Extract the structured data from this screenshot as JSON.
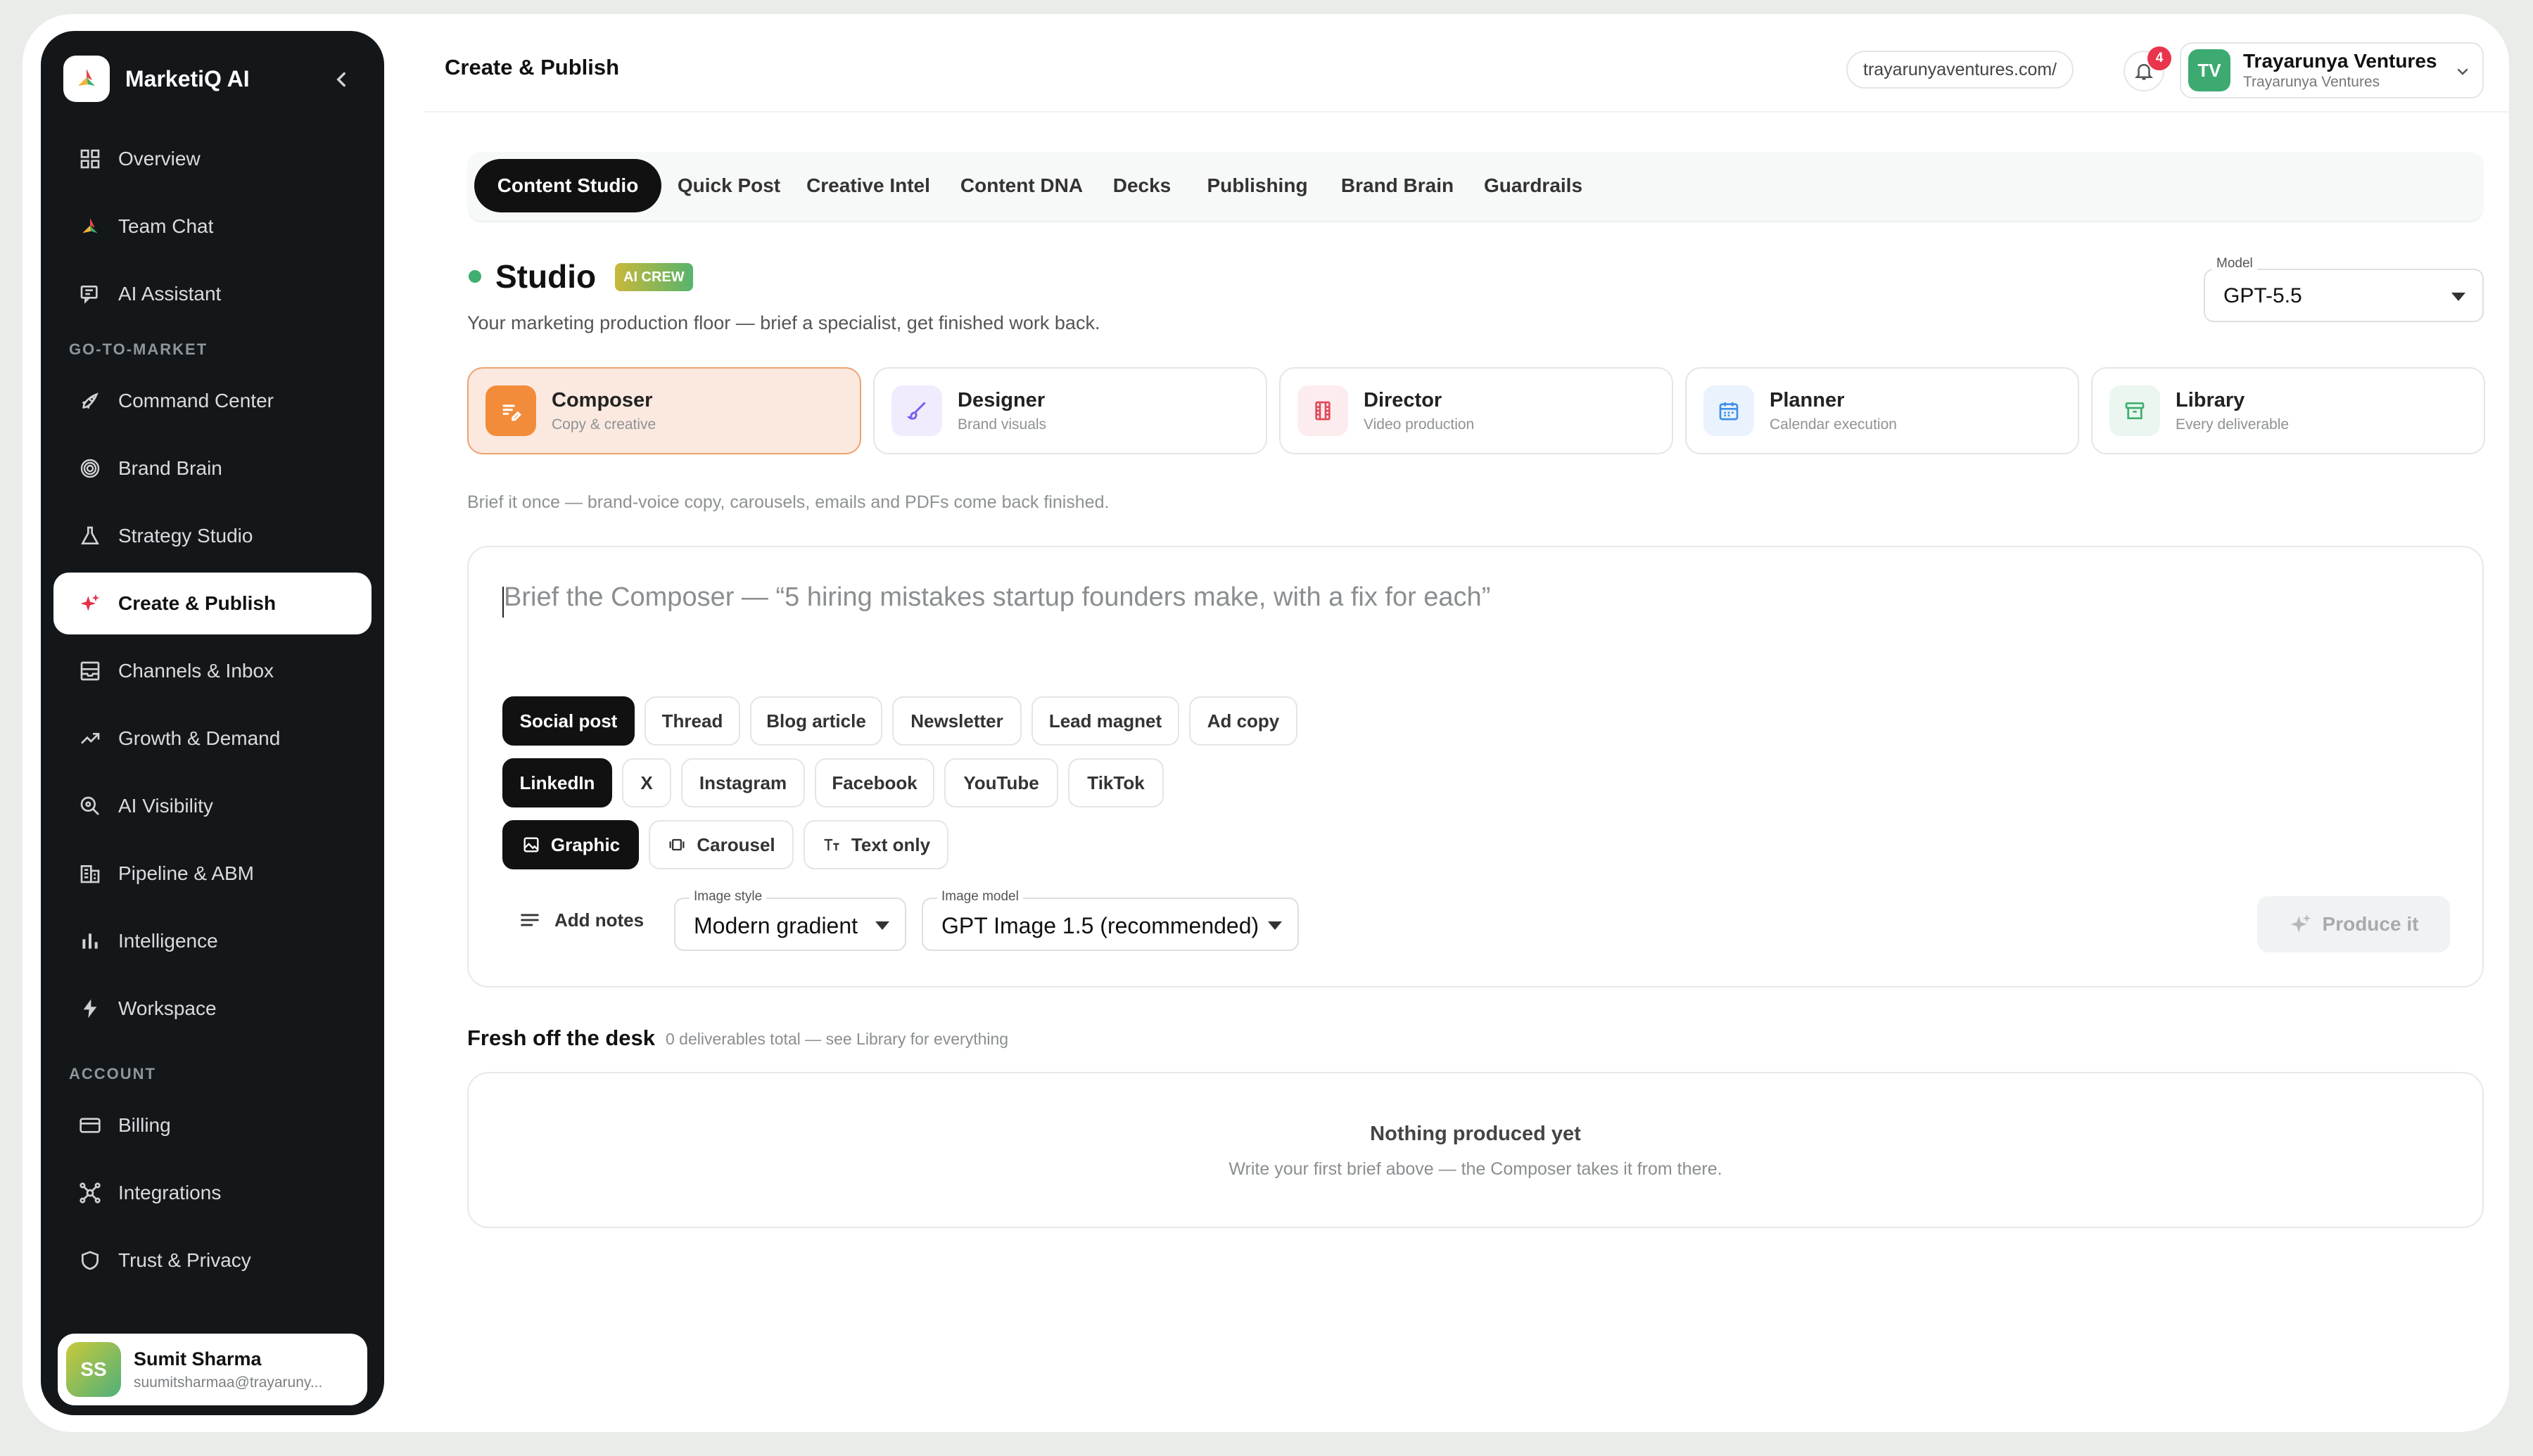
{
  "sidebar": {
    "brand": "MarketiQ AI",
    "items_top": [
      {
        "label": "Overview",
        "icon": "grid-icon"
      },
      {
        "label": "Team Chat",
        "icon": "spark-logo-icon"
      },
      {
        "label": "AI Assistant",
        "icon": "chat-icon"
      }
    ],
    "section_gtm": "GO-TO-MARKET",
    "items_gtm": [
      {
        "label": "Command Center",
        "icon": "rocket-icon"
      },
      {
        "label": "Brand Brain",
        "icon": "fingerprint-icon"
      },
      {
        "label": "Strategy Studio",
        "icon": "flask-icon"
      },
      {
        "label": "Create & Publish",
        "icon": "sparkles-icon"
      },
      {
        "label": "Channels & Inbox",
        "icon": "inbox-icon"
      },
      {
        "label": "Growth & Demand",
        "icon": "trend-up-icon"
      },
      {
        "label": "AI Visibility",
        "icon": "search-eye-icon"
      },
      {
        "label": "Pipeline & ABM",
        "icon": "building-icon"
      },
      {
        "label": "Intelligence",
        "icon": "bar-chart-icon"
      },
      {
        "label": "Workspace",
        "icon": "bolt-icon"
      }
    ],
    "section_account": "ACCOUNT",
    "items_account": [
      {
        "label": "Billing",
        "icon": "credit-card-icon"
      },
      {
        "label": "Integrations",
        "icon": "network-icon"
      },
      {
        "label": "Trust & Privacy",
        "icon": "shield-icon"
      }
    ],
    "user": {
      "initials": "SS",
      "name": "Sumit Sharma",
      "email": "suumitsharmaa@trayaruny..."
    }
  },
  "header": {
    "title": "Create & Publish",
    "url": "trayarunyaventures.com/",
    "notifications": "4",
    "account": {
      "initials": "TV",
      "name": "Trayarunya Ventures",
      "sub": "Trayarunya Ventures"
    }
  },
  "tabs": [
    "Content Studio",
    "Quick Post",
    "Creative Intel",
    "Content DNA",
    "Decks",
    "Publishing",
    "Brand Brain",
    "Guardrails"
  ],
  "studio": {
    "title": "Studio",
    "badge": "AI CREW",
    "subtitle": "Your marketing production floor — brief a specialist, get finished work back.",
    "model_label": "Model",
    "model_value": "GPT-5.5"
  },
  "specialists": [
    {
      "name": "Composer",
      "desc": "Copy & creative",
      "icon": "compose-icon",
      "color": "#f28c3a"
    },
    {
      "name": "Designer",
      "desc": "Brand visuals",
      "icon": "brush-icon",
      "color": "#7d5cf0"
    },
    {
      "name": "Director",
      "desc": "Video production",
      "icon": "film-icon",
      "color": "#e04a5a"
    },
    {
      "name": "Planner",
      "desc": "Calendar execution",
      "icon": "calendar-icon",
      "color": "#3b8ee8"
    },
    {
      "name": "Library",
      "desc": "Every deliverable",
      "icon": "archive-icon",
      "color": "#3fae6f"
    }
  ],
  "hint": "Brief it once — brand-voice copy, carousels, emails and PDFs come back finished.",
  "composer": {
    "placeholder": "Brief the Composer — “5 hiring mistakes startup founders make, with a fix for each”",
    "formats": [
      "Social post",
      "Thread",
      "Blog article",
      "Newsletter",
      "Lead magnet",
      "Ad copy"
    ],
    "platforms": [
      "LinkedIn",
      "X",
      "Instagram",
      "Facebook",
      "YouTube",
      "TikTok"
    ],
    "visuals": [
      "Graphic",
      "Carousel",
      "Text only"
    ],
    "add_notes": "Add notes",
    "image_style_label": "Image style",
    "image_style_value": "Modern gradient",
    "image_model_label": "Image model",
    "image_model_value": "GPT Image 1.5 (recommended)",
    "produce": "Produce it"
  },
  "desk": {
    "title": "Fresh off the desk",
    "meta": "0 deliverables total — see Library for everything",
    "empty_title": "Nothing produced yet",
    "empty_sub": "Write your first brief above — the Composer takes it from there."
  }
}
